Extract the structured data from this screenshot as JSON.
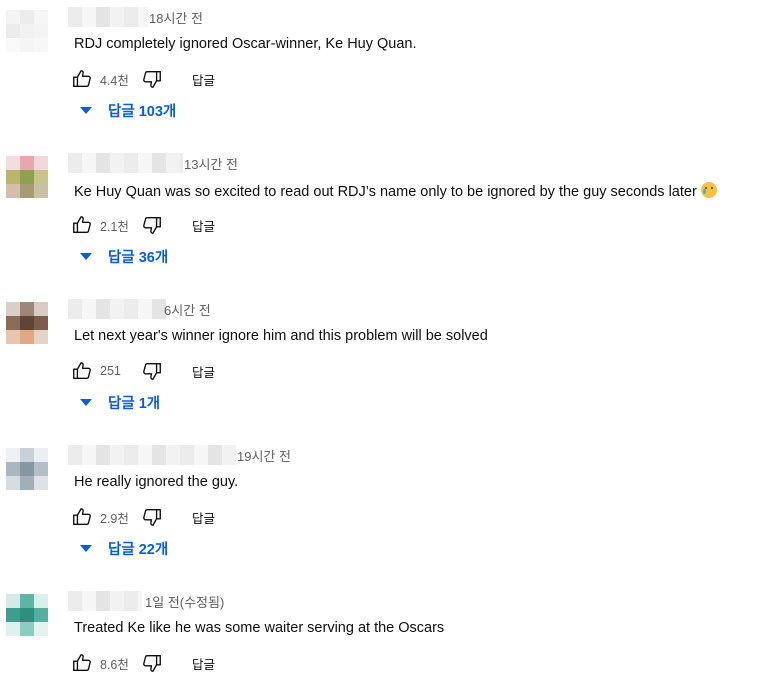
{
  "comments": [
    {
      "time": "18시간 전",
      "text": "RDJ completely ignored Oscar-winner, Ke Huy Quan.",
      "likes": "4.4천",
      "reply_label": "답글",
      "replies_label": "답글 103개",
      "avatar_colors": [
        "#f4f4f4",
        "#ececec",
        "#f6f6f6",
        "#ececec",
        "#f2f2f2",
        "#f4f4f4",
        "#f9f9f9",
        "#f5f5f5",
        "#f7f7f7"
      ],
      "name_blur_width": 80,
      "emoji": ""
    },
    {
      "time": "13시간 전",
      "text": "Ke Huy Quan was so excited to read out RDJ’s name only to be ignored by the guy seconds later",
      "likes": "2.1천",
      "reply_label": "답글",
      "replies_label": "답글 36개",
      "avatar_colors": [
        "#f3dde0",
        "#e8a6ae",
        "#f1d8da",
        "#bdb66a",
        "#8ea150",
        "#c9c48d",
        "#d6bcab",
        "#a89a71",
        "#c8c0a5"
      ],
      "name_blur_width": 115,
      "emoji": "crying-face-emoji"
    },
    {
      "time": "6시간 전",
      "text": "Let next year's winner ignore him and this problem will be solved",
      "likes": "251",
      "reply_label": "답글",
      "replies_label": "답글 1개",
      "avatar_colors": [
        "#d9cfc8",
        "#9f8777",
        "#d7cdc6",
        "#8a6c56",
        "#5f4537",
        "#7b5d4a",
        "#e6c7ae",
        "#e1a982",
        "#e3d3c8"
      ],
      "name_blur_width": 98,
      "emoji": ""
    },
    {
      "time": "19시간 전",
      "text": "He really ignored the guy.",
      "likes": "2.9천",
      "reply_label": "답글",
      "replies_label": "답글 22개",
      "avatar_colors": [
        "#eef0f2",
        "#c9d1d8",
        "#eceff1",
        "#aab6c0",
        "#8796a3",
        "#b3bec8",
        "#d5dce2",
        "#a1afbb",
        "#dce2e7"
      ],
      "name_blur_width": 168,
      "emoji": ""
    },
    {
      "time": "1일 전(수정됨)",
      "text": "Treated Ke like he was some waiter serving at the Oscars",
      "likes": "8.6천",
      "reply_label": "답글",
      "replies_label": "",
      "avatar_colors": [
        "#d2ebe6",
        "#5fb4a6",
        "#d8efea",
        "#3e9e8e",
        "#2e8f80",
        "#57ad9f",
        "#dff1ee",
        "#8ccdc2",
        "#e4f3f0"
      ],
      "name_blur_width": 74,
      "emoji": ""
    }
  ]
}
